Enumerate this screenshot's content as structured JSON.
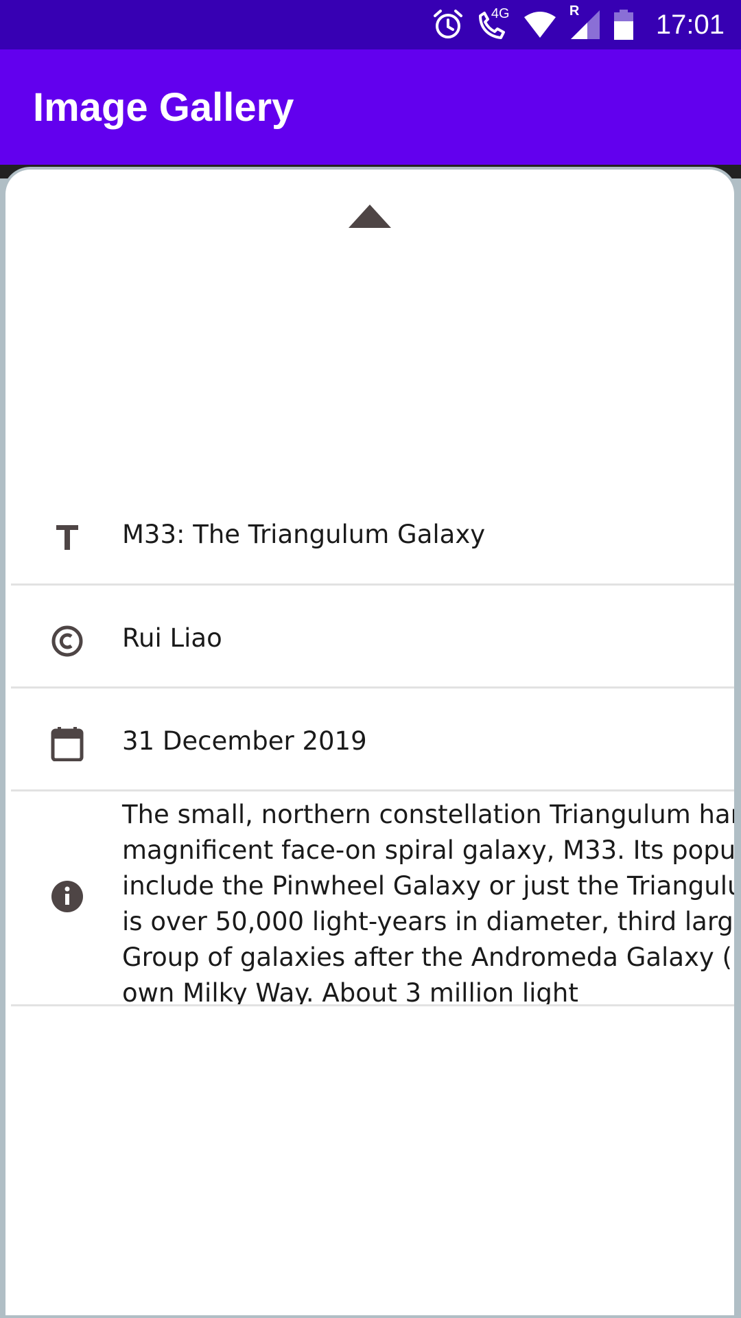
{
  "status_bar": {
    "time": "17:01",
    "network_label": "4G",
    "roaming_label": "R",
    "icons": [
      "alarm-icon",
      "volte-call-icon",
      "wifi-icon",
      "cell-signal-icon",
      "battery-icon"
    ]
  },
  "app_bar": {
    "title": "Image Gallery"
  },
  "details": {
    "title": "M33: The Triangulum Galaxy",
    "copyright": "Rui Liao",
    "date": "31 December 2019",
    "description": "The small, northern constellation Triangulum harbors the magnificent face-on spiral galaxy, M33. Its popular names include the Pinwheel Galaxy or just the Triangulum Galaxy. M33 is over 50,000 light-years in diameter, third largest in the Local Group of galaxies after the Andromeda Galaxy (M31), and our own Milky Way. About 3 million light"
  },
  "colors": {
    "status_bar": "#3700b3",
    "app_bar": "#6200ee",
    "icon": "#4e4545",
    "divider": "#e2e2e2",
    "sheet_border": "#b0bec5"
  }
}
